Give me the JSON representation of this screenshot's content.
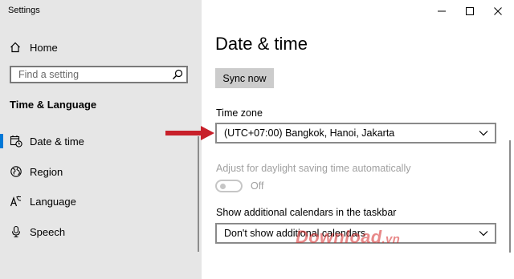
{
  "window": {
    "title": "Settings"
  },
  "sidebar": {
    "home_label": "Home",
    "search_placeholder": "Find a setting",
    "section_title": "Time & Language",
    "items": [
      {
        "label": "Date & time",
        "icon": "calendar-clock-icon",
        "active": true
      },
      {
        "label": "Region",
        "icon": "globe-icon",
        "active": false
      },
      {
        "label": "Language",
        "icon": "language-icon",
        "active": false
      },
      {
        "label": "Speech",
        "icon": "microphone-icon",
        "active": false
      }
    ]
  },
  "main": {
    "title": "Date & time",
    "sync_label": "Sync now",
    "timezone_label": "Time zone",
    "timezone_value": "(UTC+07:00) Bangkok, Hanoi, Jakarta",
    "dst_label": "Adjust for daylight saving time automatically",
    "dst_state": "Off",
    "calendars_label": "Show additional calendars in the taskbar",
    "calendars_value": "Don't show additional calendars"
  },
  "watermark": {
    "brand": "Download",
    "tld": ".vn"
  },
  "colors": {
    "accent": "#0078d7",
    "sidebar_bg": "#e6e6e6",
    "annotation_arrow": "#c8202a",
    "watermark": "#d62828"
  }
}
